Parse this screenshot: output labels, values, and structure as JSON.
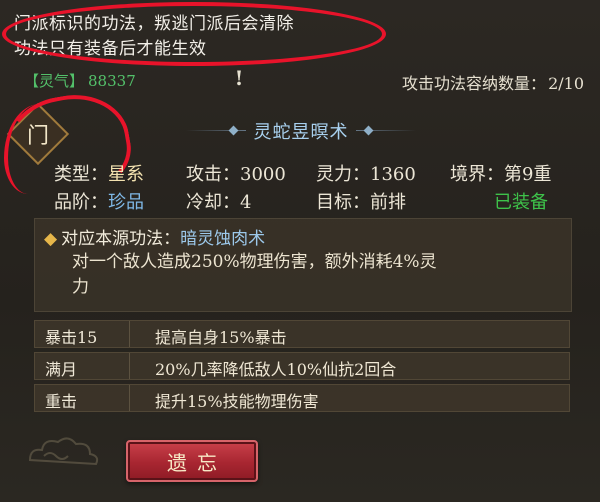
{
  "note": {
    "line1": "门派标识的功法，叛逃门派后会清除",
    "line2": "功法只有装备后才能生效"
  },
  "spirit": {
    "label": "【灵气】",
    "value": "88337"
  },
  "warning_mark": "!",
  "capacity": {
    "label": "攻击功法容纳数量：",
    "value": "2/10"
  },
  "sect_badge": "门",
  "skill": {
    "name": "灵蛇昱暝术"
  },
  "stats": {
    "type_label": "类型：",
    "type_value": "星系",
    "attack_label": "攻击：",
    "attack_value": "3000",
    "spirit_label": "灵力：",
    "spirit_value": "1360",
    "realm_label": "境界：",
    "realm_value": "第9重",
    "grade_label": "品阶：",
    "grade_value": "珍品",
    "cooldown_label": "冷却：",
    "cooldown_value": "4",
    "target_label": "目标：",
    "target_value": "前排",
    "equipped_status": "已装备"
  },
  "source": {
    "bullet": "◆",
    "label": "对应本源功法：",
    "name": "暗灵蚀肉术",
    "desc_line1": "对一个敌人造成250%物理伤害，额外消耗4%灵",
    "desc_line2": "力"
  },
  "effects": [
    {
      "name": "暴击15",
      "desc": "提高自身15%暴击"
    },
    {
      "name": "满月",
      "desc": "20%几率降低敌人10%仙抗2回合"
    },
    {
      "name": "重击",
      "desc": "提升15%技能物理伤害"
    }
  ],
  "buttons": {
    "forget": "遗忘"
  },
  "colors": {
    "annotation_red": "#e8132a",
    "spirit_green": "#53c06a",
    "title_blue": "#a8d0ee",
    "equipped_green": "#3ec24a",
    "button_red": "#a82631"
  }
}
